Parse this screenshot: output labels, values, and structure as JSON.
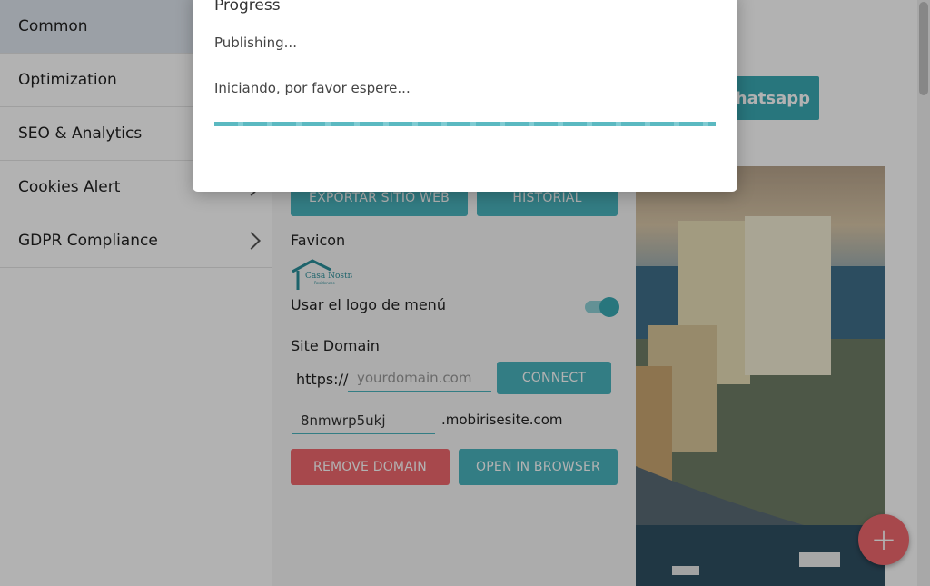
{
  "sidebar": {
    "items": [
      {
        "label": "Common",
        "active": true
      },
      {
        "label": "Optimization"
      },
      {
        "label": "SEO & Analytics"
      },
      {
        "label": "Cookies Alert"
      },
      {
        "label": "GDPR Compliance"
      }
    ]
  },
  "main": {
    "export_label": "EXPORTAR SITIO WEB",
    "history_label": "HISTORIAL",
    "favicon_label": "Favicon",
    "logo_text": "Casa Nostra",
    "logo_subtext": "Residences",
    "use_menu_logo_label": "Usar el logo de menú",
    "use_menu_logo_on": true,
    "site_domain_label": "Site Domain",
    "protocol": "https://",
    "domain_placeholder": "yourdomain.com",
    "connect_label": "CONNECT",
    "subdomain_value": "8nmwrp5ukj",
    "subdomain_suffix": ".mobirisesite.com",
    "remove_domain_label": "REMOVE DOMAIN",
    "open_browser_label": "OPEN IN BROWSER"
  },
  "preview": {
    "whatsapp_label": "Whatsapp"
  },
  "fab": {
    "icon": "plus-icon",
    "glyph": "+"
  },
  "modal": {
    "title": "Progress",
    "status": "Publishing...",
    "message": "Iniciando, por favor espere..."
  },
  "colors": {
    "accent": "#4ab3bd",
    "danger": "#f0676e"
  }
}
